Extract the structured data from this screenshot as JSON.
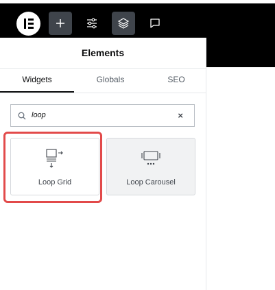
{
  "topbar": {
    "logo": "elementor-logo",
    "buttons": [
      {
        "icon": "plus-icon",
        "active": true
      },
      {
        "icon": "sliders-icon",
        "active": false
      },
      {
        "icon": "layers-icon",
        "active": true
      },
      {
        "icon": "comment-icon",
        "active": false
      }
    ]
  },
  "panel": {
    "title": "Elements",
    "tabs": [
      {
        "label": "Widgets",
        "active": true
      },
      {
        "label": "Globals",
        "active": false
      },
      {
        "label": "SEO",
        "active": false
      }
    ],
    "search": {
      "value": "loop",
      "clear": "×"
    },
    "widgets": [
      {
        "label": "Loop Grid",
        "icon": "loop-grid-icon",
        "highlighted": true
      },
      {
        "label": "Loop Carousel",
        "icon": "loop-carousel-icon",
        "highlighted": false
      }
    ]
  },
  "colors": {
    "topbar": "#000000",
    "active_button": "#3f444b",
    "highlight": "#e24a4a"
  }
}
